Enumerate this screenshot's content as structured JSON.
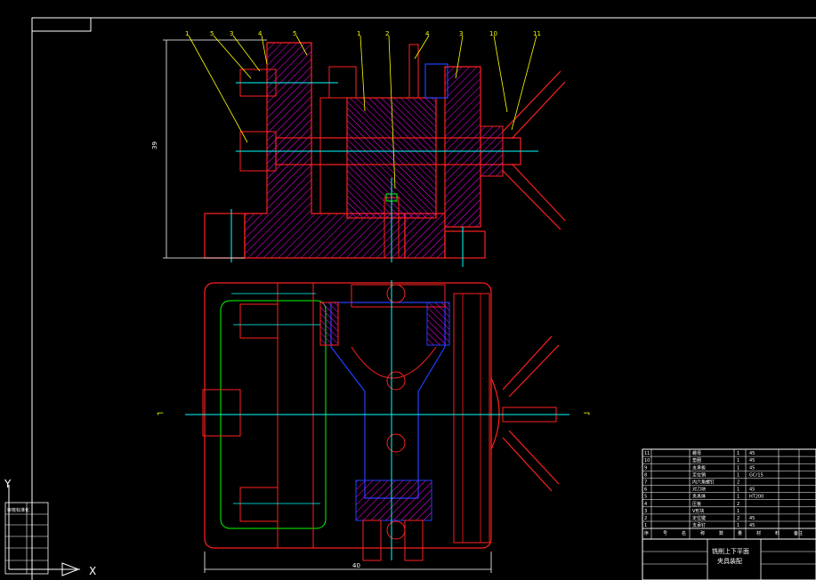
{
  "drawing": {
    "colors": {
      "background": "#000000",
      "frame": "#ffffff",
      "part_outline": "#ff2020",
      "hatch": "#ff00ff",
      "centerline": "#00ffff",
      "leader": "#ffff00",
      "blue": "#2040ff",
      "green": "#00ff00",
      "dimension": "#ffffff"
    },
    "callouts": [
      "1",
      "5",
      "3",
      "4",
      "5",
      "1",
      "2",
      "4",
      "3",
      "10",
      "11"
    ],
    "dims": {
      "height_label": "39",
      "width_label": "40"
    },
    "section_marks": {
      "left": "⌐",
      "right": "¬"
    },
    "axes": {
      "x_label": "X",
      "y_label": "Y"
    }
  },
  "title_block": {
    "title_line1": "铣削上下平面",
    "title_line2": "夹具装配",
    "parts_list": [
      {
        "no": "11",
        "name": "螺母",
        "qty": "1",
        "mat": "45"
      },
      {
        "no": "10",
        "name": "垫圈",
        "qty": "1",
        "mat": "45"
      },
      {
        "no": "9",
        "name": "支承板",
        "qty": "1",
        "mat": "45"
      },
      {
        "no": "8",
        "name": "定位销",
        "qty": "1",
        "mat": "GCr15"
      },
      {
        "no": "7",
        "name": "内六角螺钉",
        "qty": "2",
        "mat": ""
      },
      {
        "no": "6",
        "name": "对刀块",
        "qty": "1",
        "mat": "45"
      },
      {
        "no": "5",
        "name": "夹具体",
        "qty": "1",
        "mat": "HT200"
      },
      {
        "no": "4",
        "name": "压板",
        "qty": "2",
        "mat": ""
      },
      {
        "no": "3",
        "name": "V形块",
        "qty": "1",
        "mat": ""
      },
      {
        "no": "2",
        "name": "定位键",
        "qty": "2",
        "mat": "45"
      },
      {
        "no": "1",
        "name": "支承钉",
        "qty": "1",
        "mat": "45"
      }
    ],
    "header": [
      "序",
      "号",
      "名",
      "称",
      "数",
      "量",
      "材",
      "料",
      "备注"
    ]
  },
  "left_block": {
    "rows": [
      "审核标准化",
      "",
      "",
      "",
      "",
      ""
    ]
  }
}
